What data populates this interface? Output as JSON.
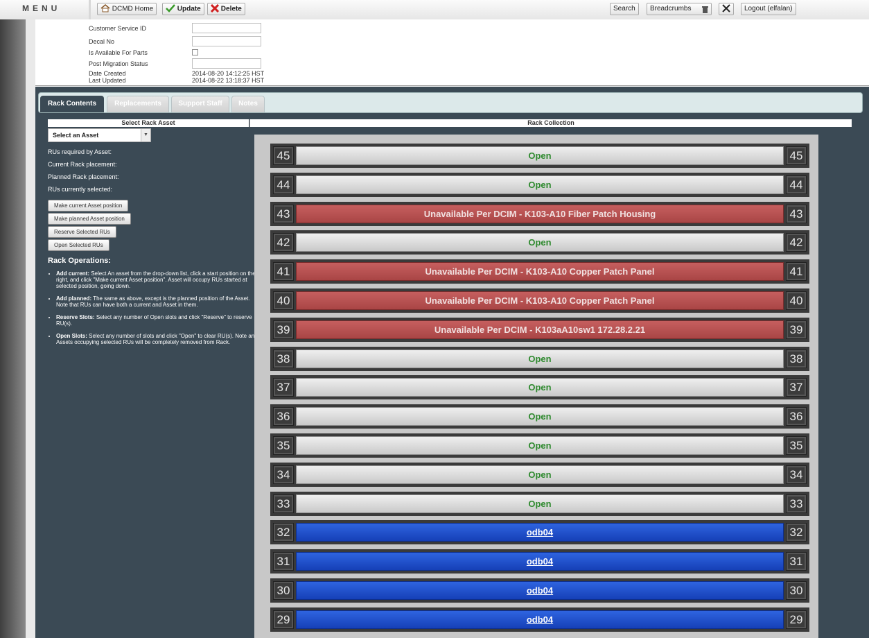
{
  "topbar": {
    "menu_label": "MENU",
    "home_label": "DCMD Home",
    "update_label": "Update",
    "delete_label": "Delete",
    "search_label": "Search",
    "breadcrumbs_label": "Breadcrumbs",
    "logout_label": "Logout (elfalan)"
  },
  "form": {
    "customer_service_id_label": "Customer Service ID",
    "customer_service_id_value": "",
    "decal_no_label": "Decal No",
    "decal_no_value": "",
    "available_for_parts_label": "Is Available For Parts",
    "post_migration_status_label": "Post Migration Status",
    "post_migration_status_value": "",
    "date_created_label": "Date Created",
    "date_created_value": "2014-08-20 14:12:25 HST",
    "last_updated_label": "Last Updated",
    "last_updated_value": "2014-08-22 13:18:37 HST"
  },
  "tabs": [
    {
      "label": "Rack Contents",
      "active": true
    },
    {
      "label": "Replacements",
      "active": false
    },
    {
      "label": "Support Staff",
      "active": false
    },
    {
      "label": "Notes",
      "active": false
    }
  ],
  "left": {
    "header": "Select Rack Asset",
    "select_value": "Select an Asset",
    "rus_required_label": "RUs required by Asset:",
    "current_placement_label": "Current Rack placement:",
    "planned_placement_label": "Planned Rack placement:",
    "rus_selected_label": "RUs currently selected:",
    "btn_current": "Make current Asset position",
    "btn_planned": "Make planned Asset position",
    "btn_reserve": "Reserve Selected RUs",
    "btn_open": "Open Selected RUs",
    "ops_title": "Rack Operations:",
    "ops": [
      {
        "term": "Add current:",
        "text": " Select An asset from the drop-down list, click a start position on the right, and click \"Make current Asset position\". Asset will occupy RUs started at selected position, going down."
      },
      {
        "term": "Add planned:",
        "text": " The same as above, except is the planned position of the Asset. Note that RUs can have both a current and Asset in them."
      },
      {
        "term": "Reserve Slots:",
        "text": " Select any number of Open slots and click \"Reserve\" to reserve RU(s)."
      },
      {
        "term": "Open Slots:",
        "text": " Select any number of slots and click \"Open\" to clear RU(s). Note any Assets occupying selected RUs will be completely removed from Rack."
      }
    ]
  },
  "rack": {
    "header": "Rack Collection",
    "units": [
      {
        "ru": "45",
        "label": "Open",
        "status": "open"
      },
      {
        "ru": "44",
        "label": "Open",
        "status": "open"
      },
      {
        "ru": "43",
        "label": "Unavailable Per DCIM - K103-A10 Fiber Patch Housing",
        "status": "unavail"
      },
      {
        "ru": "42",
        "label": "Open",
        "status": "open"
      },
      {
        "ru": "41",
        "label": "Unavailable Per DCIM - K103-A10 Copper Patch Panel",
        "status": "unavail"
      },
      {
        "ru": "40",
        "label": "Unavailable Per DCIM - K103-A10 Copper Patch Panel",
        "status": "unavail"
      },
      {
        "ru": "39",
        "label": "Unavailable Per DCIM - K103aA10sw1 172.28.2.21",
        "status": "unavail"
      },
      {
        "ru": "38",
        "label": "Open",
        "status": "open"
      },
      {
        "ru": "37",
        "label": "Open",
        "status": "open"
      },
      {
        "ru": "36",
        "label": "Open",
        "status": "open"
      },
      {
        "ru": "35",
        "label": "Open",
        "status": "open"
      },
      {
        "ru": "34",
        "label": "Open",
        "status": "open"
      },
      {
        "ru": "33",
        "label": "Open",
        "status": "open"
      },
      {
        "ru": "32",
        "label": "odb04",
        "status": "asset"
      },
      {
        "ru": "31",
        "label": "odb04",
        "status": "asset"
      },
      {
        "ru": "30",
        "label": "odb04",
        "status": "asset"
      },
      {
        "ru": "29",
        "label": "odb04",
        "status": "asset"
      }
    ]
  },
  "colors": {
    "panel_bg": "#3b4a55",
    "open_text": "#2f8a2f",
    "unavailable": "#b04c4c",
    "asset": "#1f4fcc"
  }
}
